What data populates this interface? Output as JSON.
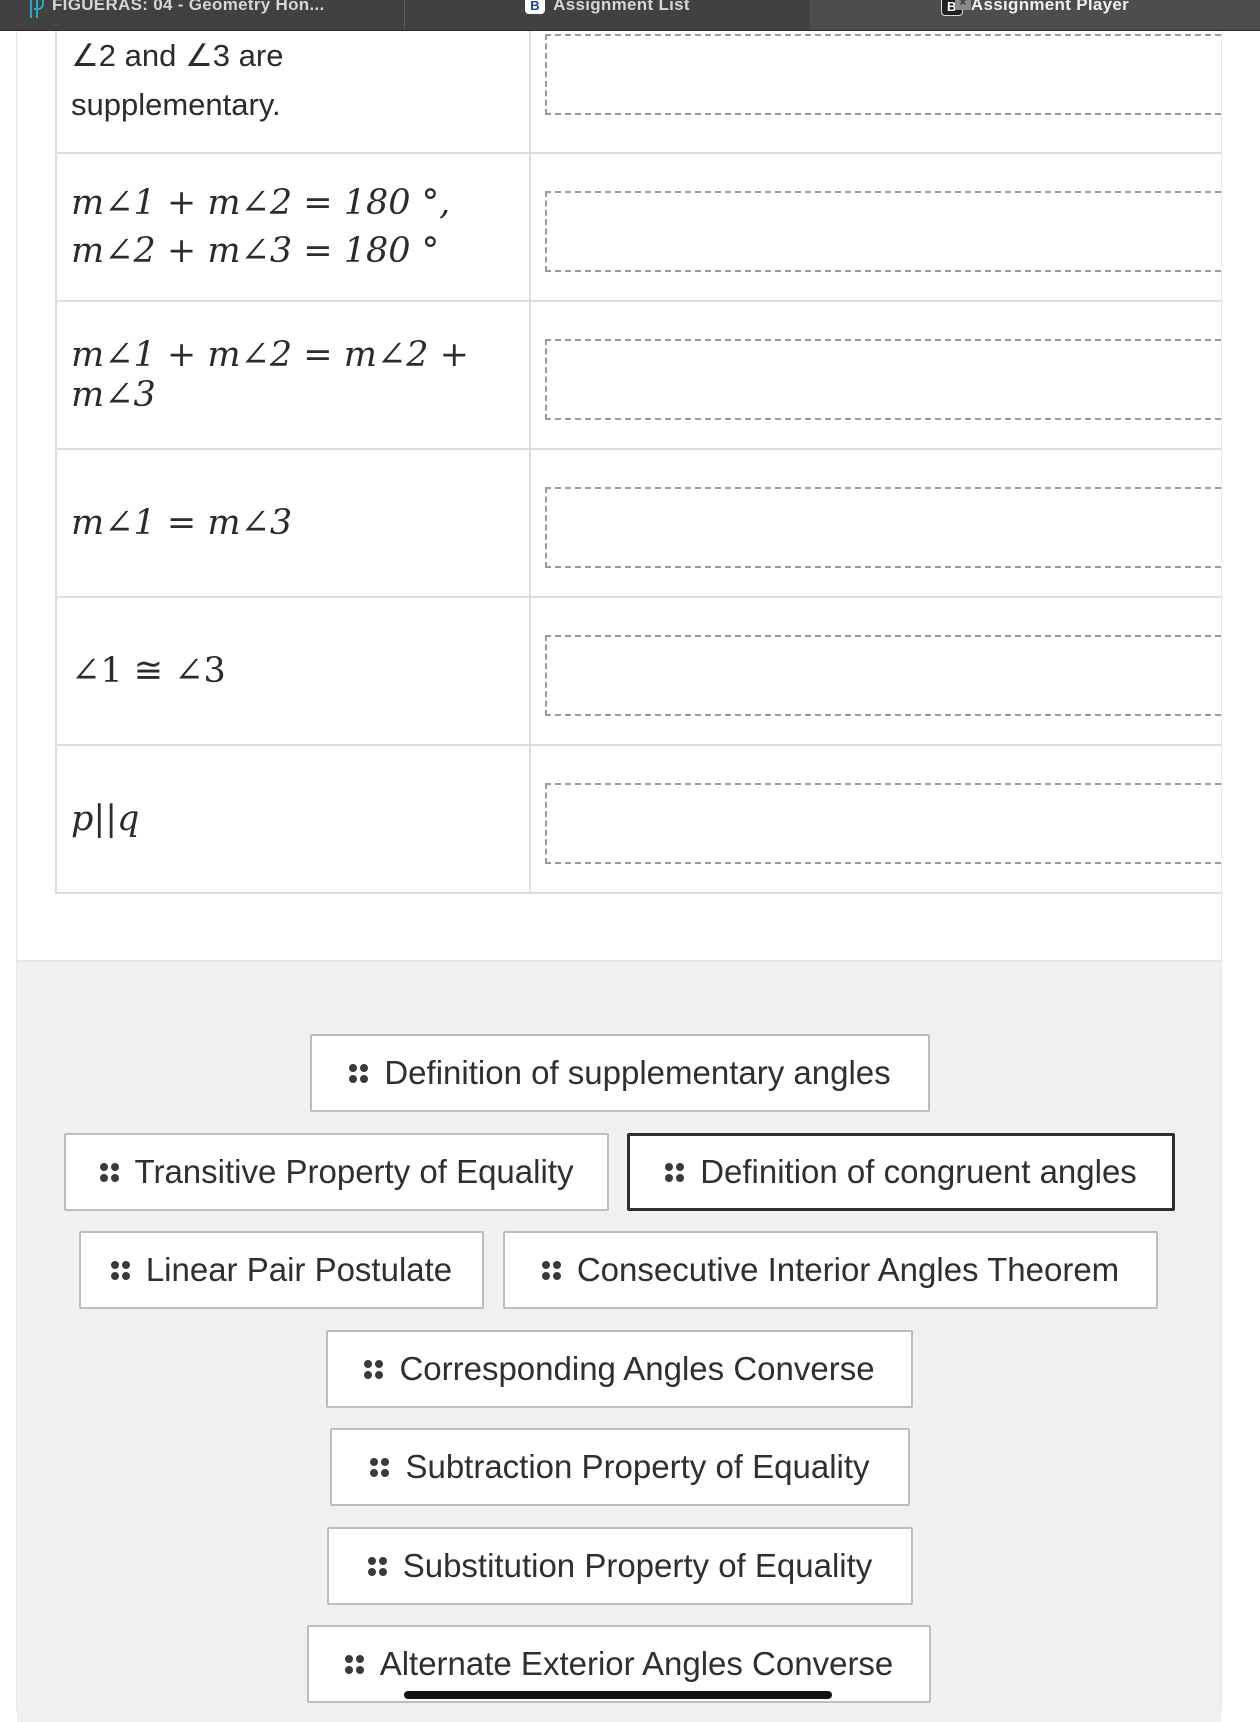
{
  "tabs": [
    {
      "label": "FIGUERAS: 04 - Geometry Hon...",
      "icon": "powerschool-logo-icon"
    },
    {
      "label": "Assignment List",
      "icon": "b-badge-icon",
      "badge": "B"
    },
    {
      "label": "Assignment Player",
      "icon": "b-badge-icon",
      "badge": "B",
      "active": true
    }
  ],
  "tab_close_glyph": "×",
  "proof": {
    "rows": [
      {
        "statement_parts": [
          "∠2 and ∠3 are",
          "supplementary."
        ],
        "reason": ""
      },
      {
        "statement_parts": [
          "m∠1 + m∠2 = 180 °,",
          "m∠2 + m∠3 = 180 °"
        ],
        "reason": ""
      },
      {
        "statement": "m∠1 + m∠2 = m∠2 + m∠3",
        "reason": ""
      },
      {
        "statement": "m∠1 = m∠3",
        "reason": ""
      },
      {
        "statement": "∠1 ≅ ∠3",
        "reason": ""
      },
      {
        "statement": "p||q",
        "reason": ""
      }
    ]
  },
  "answer_bank": {
    "chips": [
      {
        "label": "Definition of supplementary angles"
      },
      {
        "label": "Transitive Property of Equality"
      },
      {
        "label": "Definition of congruent angles",
        "selected": true
      },
      {
        "label": "Linear Pair Postulate"
      },
      {
        "label": "Consecutive Interior Angles Theorem"
      },
      {
        "label": "Corresponding Angles Converse"
      },
      {
        "label": "Subtraction Property of Equality"
      },
      {
        "label": "Substitution Property of Equality"
      },
      {
        "label": "Alternate Exterior Angles Converse"
      }
    ]
  }
}
